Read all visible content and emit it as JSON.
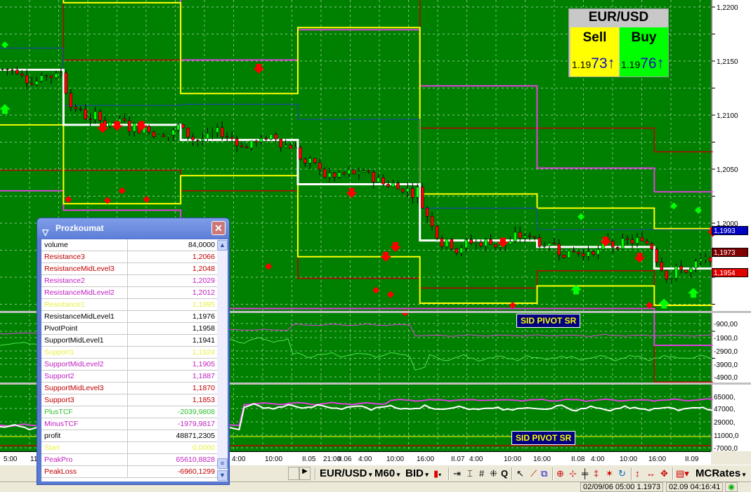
{
  "ticket": {
    "pair": "EUR/USD",
    "sell_label": "Sell",
    "buy_label": "Buy",
    "sell_prefix": "1.19",
    "sell_big": "73",
    "buy_prefix": "1.19",
    "buy_big": "76",
    "arrow": "↑"
  },
  "price_axis": {
    "main_ticks": [
      "1,2200",
      "1,2150",
      "1,2100",
      "1,2050",
      "1,2000"
    ],
    "main_tick_values": [
      1.22,
      1.215,
      1.21,
      1.205,
      1.2
    ],
    "markers": [
      {
        "label": "1,1993",
        "value": 1.1993,
        "color": "#0000c0"
      },
      {
        "label": "1,1973",
        "value": 1.1973,
        "color": "#800000"
      },
      {
        "label": "1,1954",
        "value": 1.1954,
        "color": "#e00000"
      }
    ],
    "panel2_ticks": [
      "-900,00",
      "-1900,0",
      "-2900,0",
      "-3900,0",
      "-4900,0"
    ],
    "panel3_ticks": [
      "65000,",
      "47000,",
      "29000,",
      "11000,0",
      "-7000,0"
    ]
  },
  "indicator_labels": [
    "SID PIVOT SR",
    "SID PIVOT SR"
  ],
  "time_axis": [
    "5:00",
    "11:",
    "4:00",
    "10:00",
    "II.05",
    "21:00",
    "II.06",
    "4:00",
    "10:00",
    "16:00",
    "II.07",
    "4:00",
    "10:00",
    "16:00",
    "II.08",
    "4:00",
    "10:00",
    "16:00",
    "II.09"
  ],
  "colors": {
    "background": "#008000",
    "pivot": "#ffffff",
    "level1": "#ffff00",
    "level2": "#e040e0",
    "level3": "#c00000",
    "mid": "#2040c0",
    "bull": "#00ff00",
    "bear": "#ff0000"
  },
  "pivot_segments": [
    {
      "start": -2,
      "P": 1.2142,
      "R1": 1.2215,
      "S1": 1.2091,
      "R2": 1.2215,
      "S2": 1.203,
      "R3": 1.2215,
      "S3": 1.2049,
      "M": 1.2162
    },
    {
      "start": 13,
      "P": 1.2091,
      "R1": 1.2204,
      "S1": 1.2018,
      "R2": 1.2215,
      "S2": 1.2012,
      "R3": 1.2151,
      "S3": 1.2049,
      "M": 1.2109
    },
    {
      "start": 37,
      "P": 1.2077,
      "R1": 1.212,
      "S1": 1.2044,
      "R2": 1.2151,
      "S2": 1.1921,
      "R3": 1.2215,
      "S3": 1.203,
      "M": 1.211
    },
    {
      "start": 61,
      "P": 1.2036,
      "R1": 1.2181,
      "S1": 1.1969,
      "R2": 1.2179,
      "S2": 1.1921,
      "R3": 1.2215,
      "S3": 1.1949,
      "M": 1.2096
    },
    {
      "start": 86,
      "P": 1.1984,
      "R1": 1.2027,
      "S1": 1.1926,
      "R2": 1.2127,
      "S2": 1.1921,
      "R3": 1.2088,
      "S3": 1.194,
      "M": 1.2014
    },
    {
      "start": 110,
      "P": 1.1978,
      "R1": 1.2014,
      "S1": 1.1942,
      "R2": 1.2051,
      "S2": 1.1921,
      "R3": 1.2088,
      "S3": 1.1956,
      "M": 1.1994
    },
    {
      "start": 134,
      "P": 1.1958,
      "R1": 1.1995,
      "S1": 1.1924,
      "R2": 1.2029,
      "S2": 1.1887,
      "R3": 1.2066,
      "S3": 1.1853,
      "M": 1.1994,
      "end": 146
    }
  ],
  "panel": {
    "title": "Prozkoumat",
    "rows": [
      {
        "name": "volume",
        "value": "84,0000",
        "color": "#000000"
      },
      {
        "name": "Resistance3",
        "value": "1,2066",
        "color": "#c00000"
      },
      {
        "name": "ResistanceMidLevel3",
        "value": "1,2048",
        "color": "#c00000"
      },
      {
        "name": "Resistance2",
        "value": "1,2029",
        "color": "#c020c0"
      },
      {
        "name": "ResistanceMidLevel2",
        "value": "1,2012",
        "color": "#c020c0"
      },
      {
        "name": "Resistance1",
        "value": "1,1995",
        "color": "#e8f040"
      },
      {
        "name": "ResistanceMidLevel1",
        "value": "1,1976",
        "color": "#000000"
      },
      {
        "name": "PivotPoint",
        "value": "1,1958",
        "color": "#000000"
      },
      {
        "name": "SupportMidLevel1",
        "value": "1,1941",
        "color": "#000000"
      },
      {
        "name": "Support1",
        "value": "1,1924",
        "color": "#e8f040"
      },
      {
        "name": "SupportMidLevel2",
        "value": "1,1905",
        "color": "#c020c0"
      },
      {
        "name": "Support2",
        "value": "1,1887",
        "color": "#c020c0"
      },
      {
        "name": "SupportMidLevel3",
        "value": "1,1870",
        "color": "#c00000"
      },
      {
        "name": "Support3",
        "value": "1,1853",
        "color": "#c00000"
      },
      {
        "name": "PlusTCF",
        "value": "-2039,9808",
        "color": "#30c030"
      },
      {
        "name": "MinusTCF",
        "value": "-1979,9817",
        "color": "#c020c0"
      },
      {
        "name": "profit",
        "value": "48871,2305",
        "color": "#000000"
      },
      {
        "name": "Start",
        "value": "0,0000",
        "color": "#e8f040"
      },
      {
        "name": "PeakPro",
        "value": "65610,8828",
        "color": "#c020c0"
      },
      {
        "name": "PeakLoss",
        "value": "-6960,1299",
        "color": "#c00000"
      }
    ]
  },
  "toolbar": {
    "symbol": "EUR/USD",
    "period": "M60",
    "price_type": "BID",
    "rates": "MCRates"
  },
  "status": {
    "bar_info": "02/09/06 05:00  1.1973",
    "clock": "02.09 04:16:41"
  }
}
